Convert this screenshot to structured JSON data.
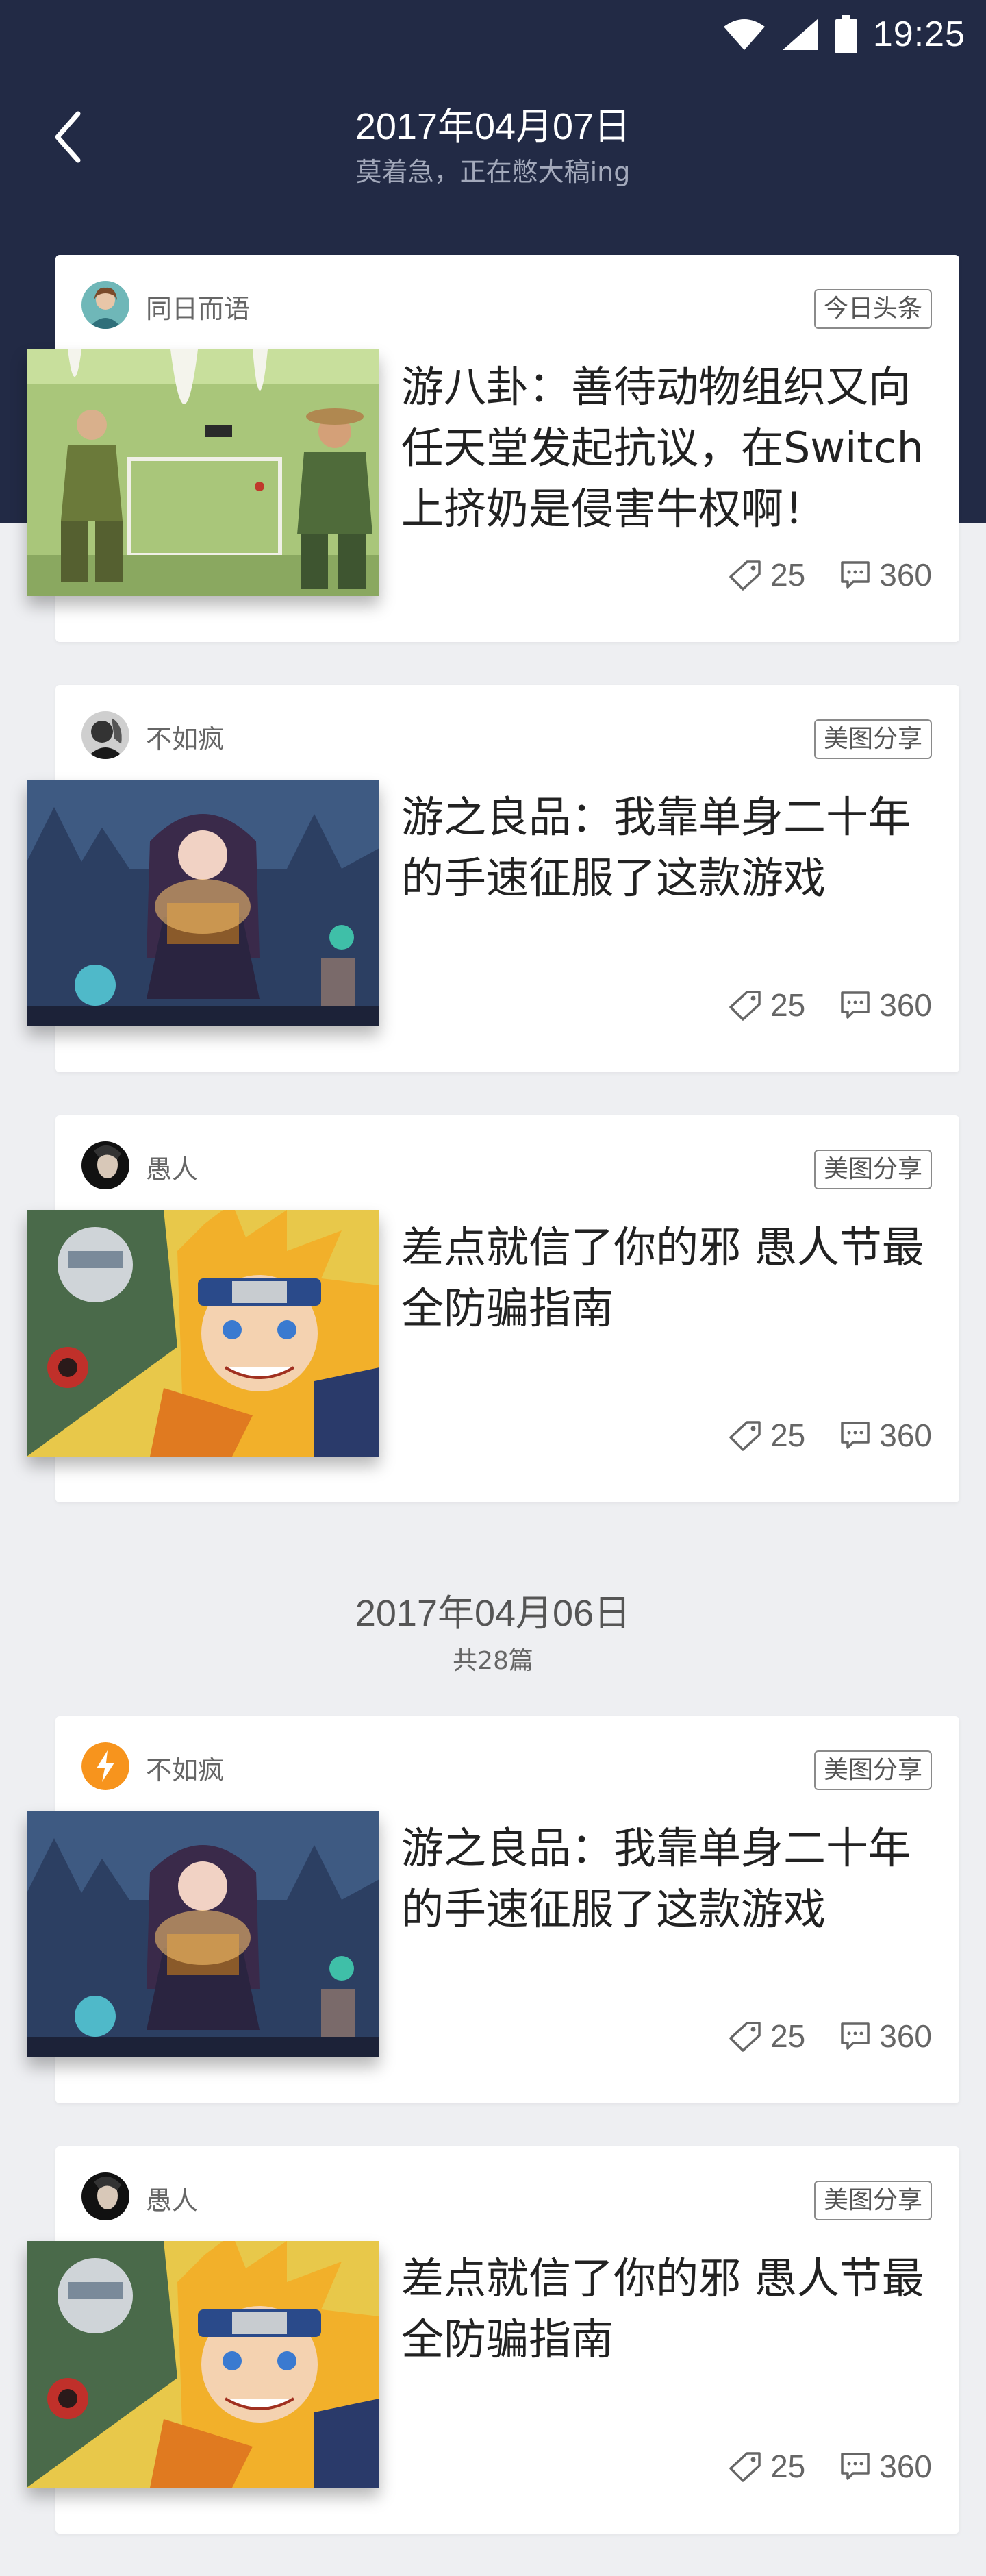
{
  "status_bar": {
    "time": "19:25"
  },
  "nav": {
    "title": "2017年04月07日",
    "subtitle": "莫着急，正在憋大稿ing"
  },
  "section2": {
    "date": "2017年04月06日",
    "count": "共28篇"
  },
  "cards": [
    {
      "author": "同日而语",
      "tag": "今日头条",
      "title": "游八卦：善待动物组织又向任天堂发起抗议，在Switch上挤奶是侵害牛权啊！",
      "likes": "25",
      "comments": "360"
    },
    {
      "author": "不如疯",
      "tag": "美图分享",
      "title": "游之良品：我靠单身二十年的手速征服了这款游戏",
      "likes": "25",
      "comments": "360"
    },
    {
      "author": "愚人",
      "tag": "美图分享",
      "title": "差点就信了你的邪 愚人节最全防骗指南",
      "likes": "25",
      "comments": "360"
    },
    {
      "author": "不如疯",
      "tag": "美图分享",
      "title": "游之良品：我靠单身二十年的手速征服了这款游戏",
      "likes": "25",
      "comments": "360"
    },
    {
      "author": "愚人",
      "tag": "美图分享",
      "title": "差点就信了你的邪 愚人节最全防骗指南",
      "likes": "25",
      "comments": "360"
    }
  ],
  "colors": {
    "header": "#222a45",
    "background": "#eeeff2",
    "card": "#ffffff",
    "accent_avatar": "#f7941d"
  }
}
